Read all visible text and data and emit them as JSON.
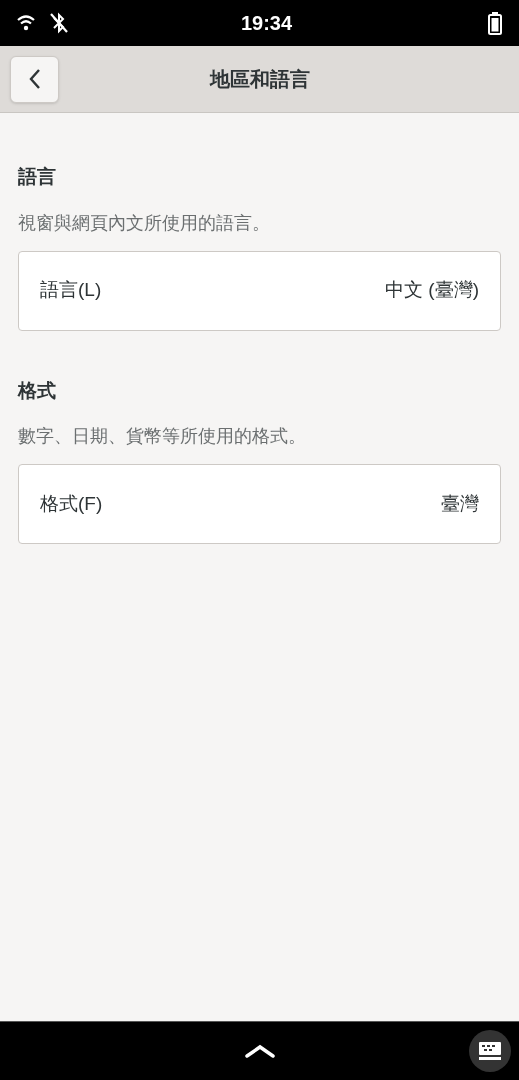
{
  "status_bar": {
    "time": "19:34"
  },
  "header": {
    "title": "地區和語言"
  },
  "sections": [
    {
      "title": "語言",
      "description": "視窗與網頁內文所使用的語言。",
      "row": {
        "label": "語言(L)",
        "value": "中文 (臺灣)"
      }
    },
    {
      "title": "格式",
      "description": "數字、日期、貨幣等所使用的格式。",
      "row": {
        "label": "格式(F)",
        "value": "臺灣"
      }
    }
  ]
}
